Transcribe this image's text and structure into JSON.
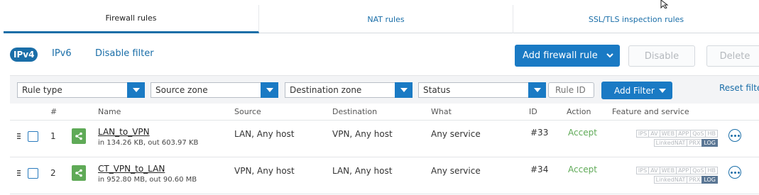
{
  "tabs": [
    {
      "label": "Firewall rules",
      "active": true
    },
    {
      "label": "NAT rules",
      "active": false
    },
    {
      "label": "SSL/TLS inspection rules",
      "active": false
    }
  ],
  "toolbar": {
    "ipv4": "IPv4",
    "ipv6": "IPv6",
    "disable_filter": "Disable filter",
    "add_rule": "Add firewall rule",
    "disable": "Disable",
    "delete": "Delete"
  },
  "filters": {
    "rule_type": "Rule type",
    "source_zone": "Source zone",
    "destination_zone": "Destination zone",
    "status": "Status",
    "rule_id_placeholder": "Rule ID",
    "add_filter": "Add Filter",
    "reset": "Reset filte"
  },
  "columns": {
    "num": "#",
    "name": "Name",
    "source": "Source",
    "destination": "Destination",
    "what": "What",
    "id": "ID",
    "action": "Action",
    "feature": "Feature and service"
  },
  "rows": [
    {
      "num": "1",
      "name": "LAN_to_VPN",
      "traffic": "in 134.26 KB, out 603.97 KB",
      "source": "LAN, Any host",
      "destination": "VPN, Any host",
      "what": "Any service",
      "id": "#33",
      "action": "Accept"
    },
    {
      "num": "2",
      "name": "CT_VPN_to_LAN",
      "traffic": "in 952.80 MB, out 90.60 MB",
      "source": "VPN, Any host",
      "destination": "LAN, Any host",
      "what": "Any service",
      "id": "#34",
      "action": "Accept"
    }
  ],
  "badges": {
    "line1": [
      "IPS",
      "AV",
      "WEB",
      "APP",
      "QoS",
      "HB"
    ],
    "line2": [
      "LinkedNAT",
      "PRX",
      "LOG"
    ],
    "active": "LOG"
  },
  "colors": {
    "accent": "#1a7ac4",
    "accept": "#5faa57",
    "rule_icon": "#5faa57"
  },
  "icons": {
    "drag": "drag-handle-icon",
    "rule": "share-icon",
    "more": "more-options-icon",
    "dropdown": "chevron-down-icon"
  }
}
